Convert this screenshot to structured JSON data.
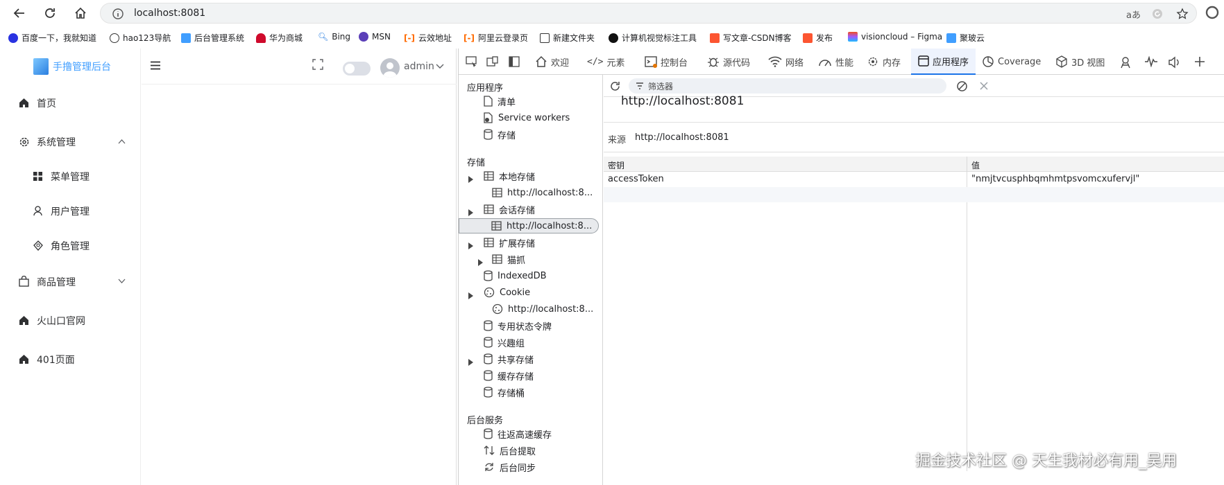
{
  "browser": {
    "url": "localhost:8081",
    "reader_label": "aあ"
  },
  "bookmarks": [
    {
      "label": "百度一下，我就知道",
      "color": "#2932e1"
    },
    {
      "label": "hao123导航",
      "color": "#333333"
    },
    {
      "label": "后台管理系统",
      "color": "#409eff"
    },
    {
      "label": "华为商城",
      "color": "#cf0a2c"
    },
    {
      "label": "Bing",
      "color": "#2b7fe0"
    },
    {
      "label": "MSN",
      "color": "#5b3fb8"
    },
    {
      "label": "云效地址",
      "color": "#ff6a00"
    },
    {
      "label": "阿里云登录页",
      "color": "#ff6a00"
    },
    {
      "label": "新建文件夹",
      "color": "#333333"
    },
    {
      "label": "计算机视觉标注工具",
      "color": "#111111"
    },
    {
      "label": "写文章-CSDN博客",
      "color": "#fc5531"
    },
    {
      "label": "发布",
      "color": "#fc5531"
    },
    {
      "label": "visioncloud – Figma",
      "color": "#f24e1e"
    },
    {
      "label": "聚玻云",
      "color": "#409eff"
    }
  ],
  "app": {
    "logo_text": "手撸管理后台",
    "user": "admin",
    "menu": [
      {
        "label": "首页",
        "icon": "home-icon"
      },
      {
        "label": "系统管理",
        "icon": "gear-icon",
        "expanded": true
      },
      {
        "label": "菜单管理",
        "icon": "grid-icon",
        "sub": true
      },
      {
        "label": "用户管理",
        "icon": "user-icon",
        "sub": true
      },
      {
        "label": "角色管理",
        "icon": "diamond-icon",
        "sub": true
      },
      {
        "label": "商品管理",
        "icon": "bag-icon",
        "expanded": false
      },
      {
        "label": "火山口官网",
        "icon": "home-icon"
      },
      {
        "label": "401页面",
        "icon": "home-icon"
      }
    ]
  },
  "devtools": {
    "tabs": [
      "欢迎",
      "元素",
      "控制台",
      "源代码",
      "网络",
      "性能",
      "内存",
      "应用程序",
      "Coverage",
      "3D 视图"
    ],
    "active_tab": "应用程序",
    "filter_placeholder": "筛选器",
    "tree": {
      "sections": [
        "应用程序",
        "存储",
        "后台服务"
      ],
      "app_items": [
        "清单",
        "Service workers",
        "存储"
      ],
      "storage_items": [
        {
          "label": "本地存储",
          "caret": true
        },
        {
          "label": "http://localhost:8...",
          "indent": true
        },
        {
          "label": "会话存储",
          "caret": true
        },
        {
          "label": "http://localhost:8...",
          "indent": true,
          "selected": true
        },
        {
          "label": "扩展存储",
          "caret": true
        },
        {
          "label": "猫抓",
          "caret": true,
          "indent": true
        },
        {
          "label": "IndexedDB"
        },
        {
          "label": "Cookie",
          "caret": true
        },
        {
          "label": "http://localhost:8...",
          "indent": true
        },
        {
          "label": "专用状态令牌"
        },
        {
          "label": "兴趣组"
        },
        {
          "label": "共享存储",
          "caret": true
        },
        {
          "label": "缓存存储"
        },
        {
          "label": "存储桶"
        }
      ],
      "bg_items": [
        "往返高速缓存",
        "后台提取",
        "后台同步"
      ]
    },
    "origin_title": "http://localhost:8081",
    "origin_label": "来源",
    "origin_value": "http://localhost:8081",
    "table": {
      "headers": [
        "密钥",
        "值"
      ],
      "rows": [
        {
          "key": "accessToken",
          "value": "\"nmjtvcusphbqmhmtpsvomcxufervjl\""
        }
      ]
    }
  },
  "watermark": "掘金技术社区 @ 天生我材必有用_吴用"
}
